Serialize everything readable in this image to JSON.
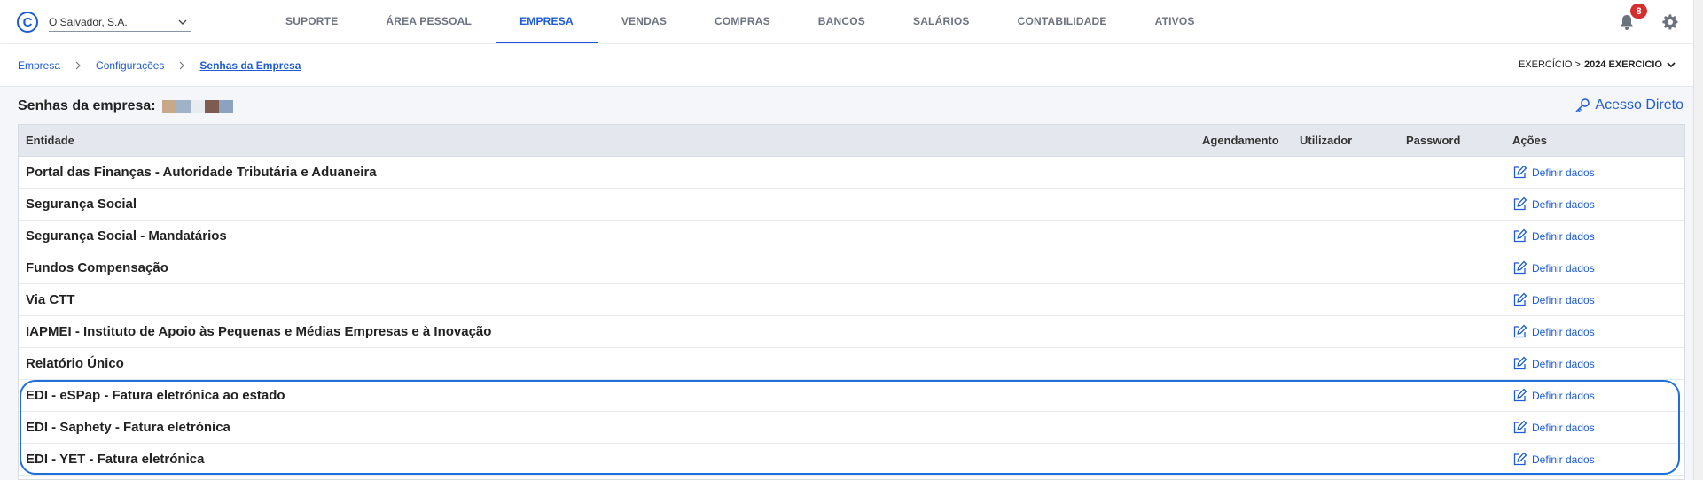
{
  "header": {
    "company": "O Salvador, S.A.",
    "nav": [
      {
        "label": "SUPORTE",
        "active": false
      },
      {
        "label": "ÁREA PESSOAL",
        "active": false
      },
      {
        "label": "EMPRESA",
        "active": true
      },
      {
        "label": "VENDAS",
        "active": false
      },
      {
        "label": "COMPRAS",
        "active": false
      },
      {
        "label": "BANCOS",
        "active": false
      },
      {
        "label": "SALÁRIOS",
        "active": false
      },
      {
        "label": "CONTABILIDADE",
        "active": false
      },
      {
        "label": "ATIVOS",
        "active": false
      }
    ],
    "notifications": "8"
  },
  "breadcrumb": {
    "items": [
      "Empresa",
      "Configurações",
      "Senhas da Empresa"
    ]
  },
  "exercise": {
    "prefix": "EXERCÍCIO >",
    "value": "2024 EXERCICIO"
  },
  "page": {
    "title": "Senhas da empresa:",
    "direct_access": "Acesso Direto"
  },
  "table": {
    "columns": [
      "Entidade",
      "Agendamento",
      "Utilizador",
      "Password",
      "Ações"
    ],
    "action_label": "Definir dados",
    "rows": [
      "Portal das Finanças - Autoridade Tributária e Aduaneira",
      "Segurança Social",
      "Segurança Social - Mandatários",
      "Fundos Compensação",
      "Via CTT",
      "IAPMEI - Instituto de Apoio às Pequenas e Médias Empresas e à Inovação",
      "Relatório Único",
      "EDI - eSPap - Fatura eletrónica ao estado",
      "EDI - Saphety - Fatura eletrónica",
      "EDI - YET - Fatura eletrónica"
    ]
  },
  "colors": {
    "accent": "#1e5bd6",
    "badge": "#d32f2f",
    "header_bg": "#e4e8ee"
  }
}
